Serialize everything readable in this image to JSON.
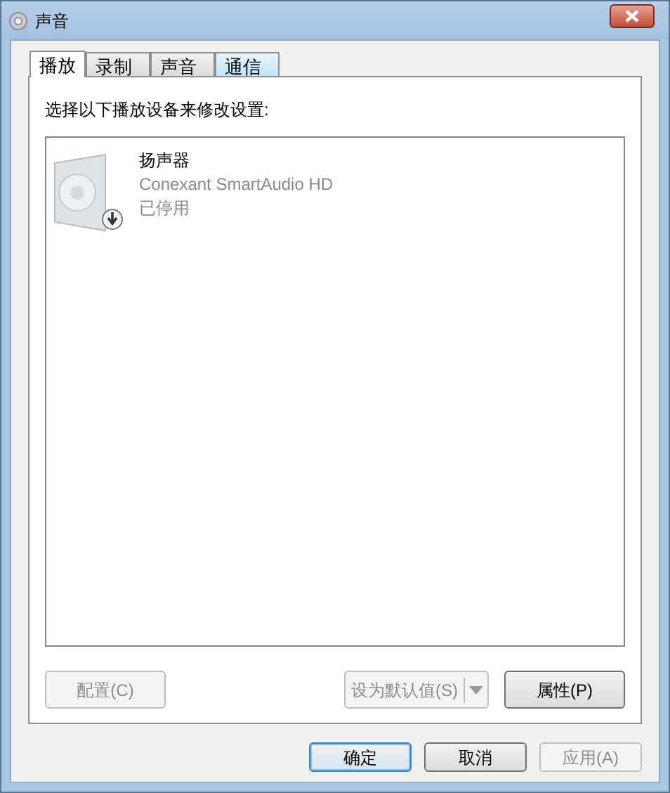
{
  "window": {
    "title": "声音"
  },
  "tabs": [
    {
      "label": "播放",
      "selected": true,
      "hovered": false
    },
    {
      "label": "录制",
      "selected": false,
      "hovered": false
    },
    {
      "label": "声音",
      "selected": false,
      "hovered": false
    },
    {
      "label": "通信",
      "selected": false,
      "hovered": true
    }
  ],
  "instruction": "选择以下播放设备来修改设置:",
  "devices": [
    {
      "name": "扬声器",
      "description": "Conexant SmartAudio HD",
      "status": "已停用",
      "selected": false,
      "disabled": true
    }
  ],
  "panel_buttons": [
    {
      "kind": "button",
      "label": "配置(C)",
      "disabled": true
    },
    {
      "kind": "split",
      "label": "设为默认值(S)",
      "disabled": true
    },
    {
      "kind": "button",
      "label": "属性(P)",
      "disabled": false
    }
  ],
  "dialog_buttons": [
    {
      "label": "确定",
      "default": true,
      "disabled": false
    },
    {
      "label": "取消",
      "default": false,
      "disabled": false
    },
    {
      "label": "应用(A)",
      "default": false,
      "disabled": true
    }
  ]
}
